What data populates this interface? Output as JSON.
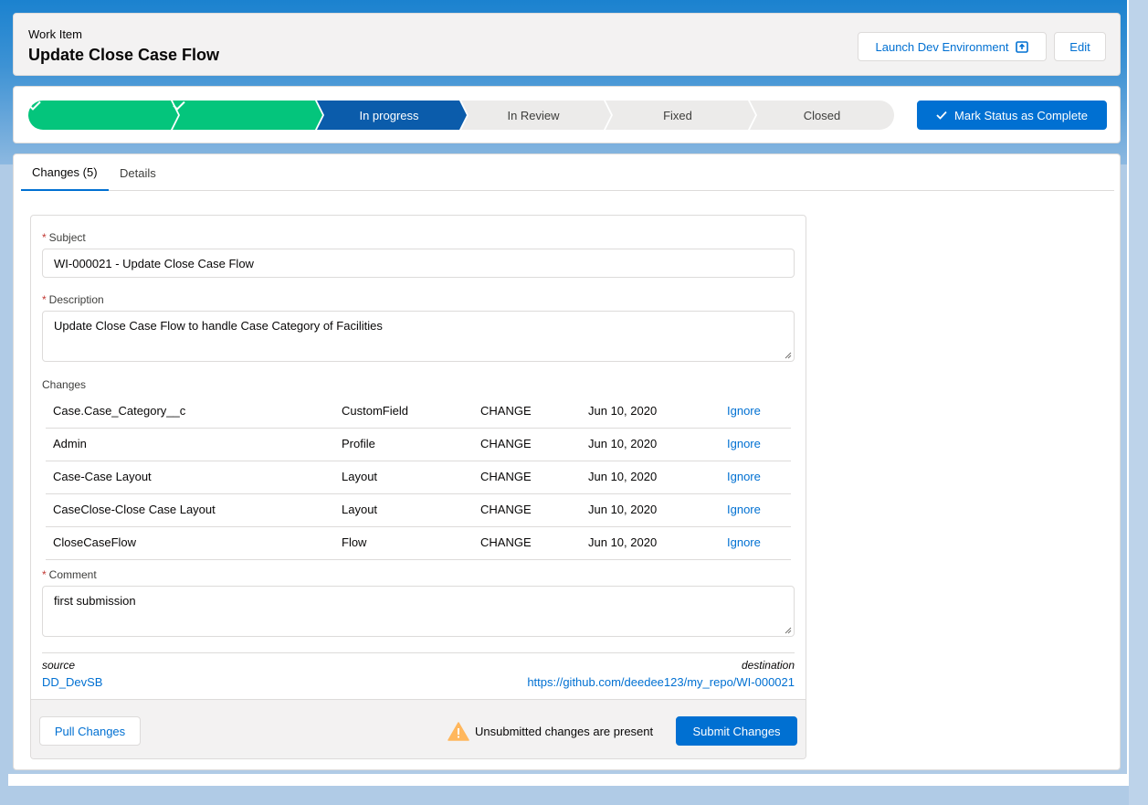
{
  "header": {
    "label": "Work Item",
    "title": "Update Close Case Flow",
    "launch_label": "Launch Dev Environment",
    "edit_label": "Edit"
  },
  "path": {
    "stages": [
      {
        "label": "",
        "state": "complete"
      },
      {
        "label": "",
        "state": "complete"
      },
      {
        "label": "In progress",
        "state": "current"
      },
      {
        "label": "In Review",
        "state": "incomplete"
      },
      {
        "label": "Fixed",
        "state": "incomplete"
      },
      {
        "label": "Closed",
        "state": "incomplete"
      }
    ],
    "mark_complete_label": "Mark Status as Complete",
    "colors": {
      "complete": "#04c57c",
      "current": "#0b5cab",
      "incomplete": "#ecebea"
    }
  },
  "tabs": [
    {
      "label": "Changes (5)",
      "active": true
    },
    {
      "label": "Details",
      "active": false
    }
  ],
  "form": {
    "subject_label": "Subject",
    "subject_value": "WI-000021 - Update Close Case Flow",
    "description_label": "Description",
    "description_value": "Update Close Case Flow to handle Case Category of Facilities",
    "changes_label": "Changes",
    "changes": [
      {
        "name": "Case.Case_Category__c",
        "type": "CustomField",
        "action": "CHANGE",
        "date": "Jun 10, 2020",
        "ignore": "Ignore"
      },
      {
        "name": "Admin",
        "type": "Profile",
        "action": "CHANGE",
        "date": "Jun 10, 2020",
        "ignore": "Ignore"
      },
      {
        "name": "Case-Case Layout",
        "type": "Layout",
        "action": "CHANGE",
        "date": "Jun 10, 2020",
        "ignore": "Ignore"
      },
      {
        "name": "CaseClose-Close Case Layout",
        "type": "Layout",
        "action": "CHANGE",
        "date": "Jun 10, 2020",
        "ignore": "Ignore"
      },
      {
        "name": "CloseCaseFlow",
        "type": "Flow",
        "action": "CHANGE",
        "date": "Jun 10, 2020",
        "ignore": "Ignore"
      }
    ],
    "comment_label": "Comment",
    "comment_value": "first submission",
    "source_label": "source",
    "source_value": "DD_DevSB",
    "destination_label": "destination",
    "destination_value": "https://github.com/deedee123/my_repo/WI-000021"
  },
  "footer": {
    "pull_label": "Pull Changes",
    "warning_text": "Unsubmitted changes are present",
    "submit_label": "Submit Changes"
  },
  "icons": {
    "launch": "external-window-icon",
    "check": "check-icon",
    "warning": "warning-icon"
  }
}
